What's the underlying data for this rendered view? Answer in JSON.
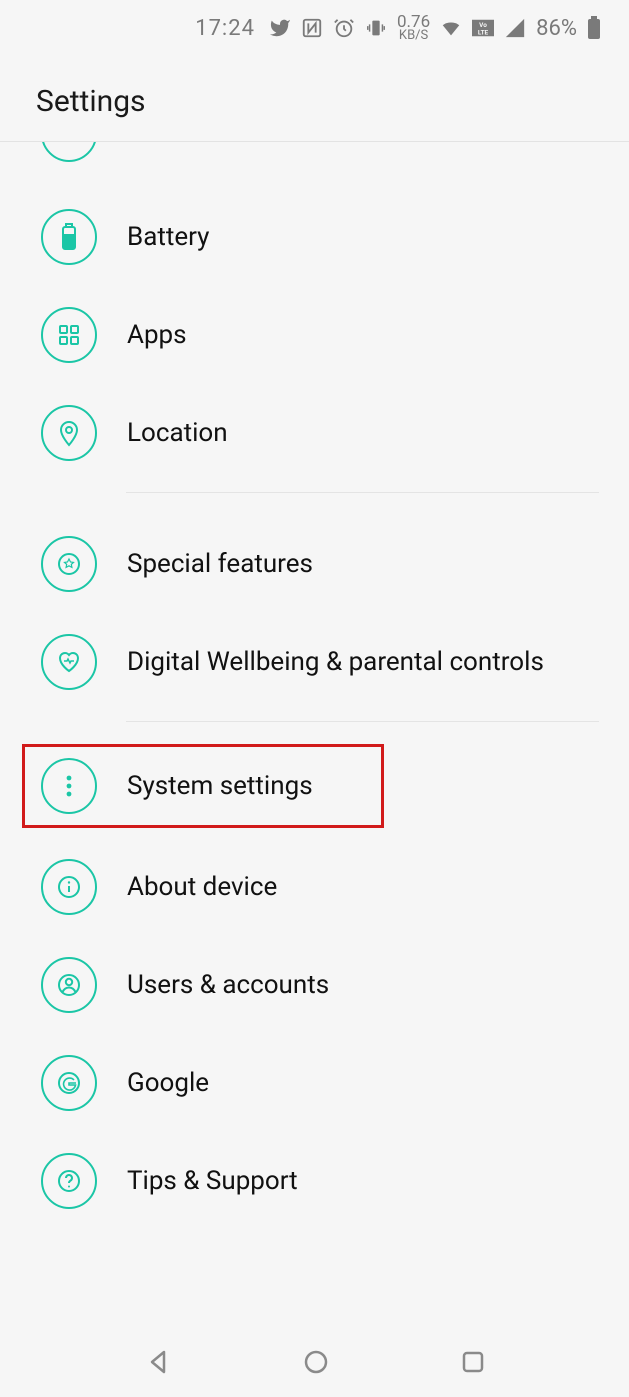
{
  "status": {
    "time": "17:24",
    "net_rate": "0.76",
    "net_unit": "KB/S",
    "battery_pct": "86%"
  },
  "header": {
    "title": "Settings"
  },
  "items": {
    "battery": "Battery",
    "apps": "Apps",
    "location": "Location",
    "special": "Special features",
    "wellbeing": "Digital Wellbeing & parental controls",
    "system": "System settings",
    "about": "About device",
    "users": "Users & accounts",
    "google": "Google",
    "tips": "Tips & Support"
  }
}
